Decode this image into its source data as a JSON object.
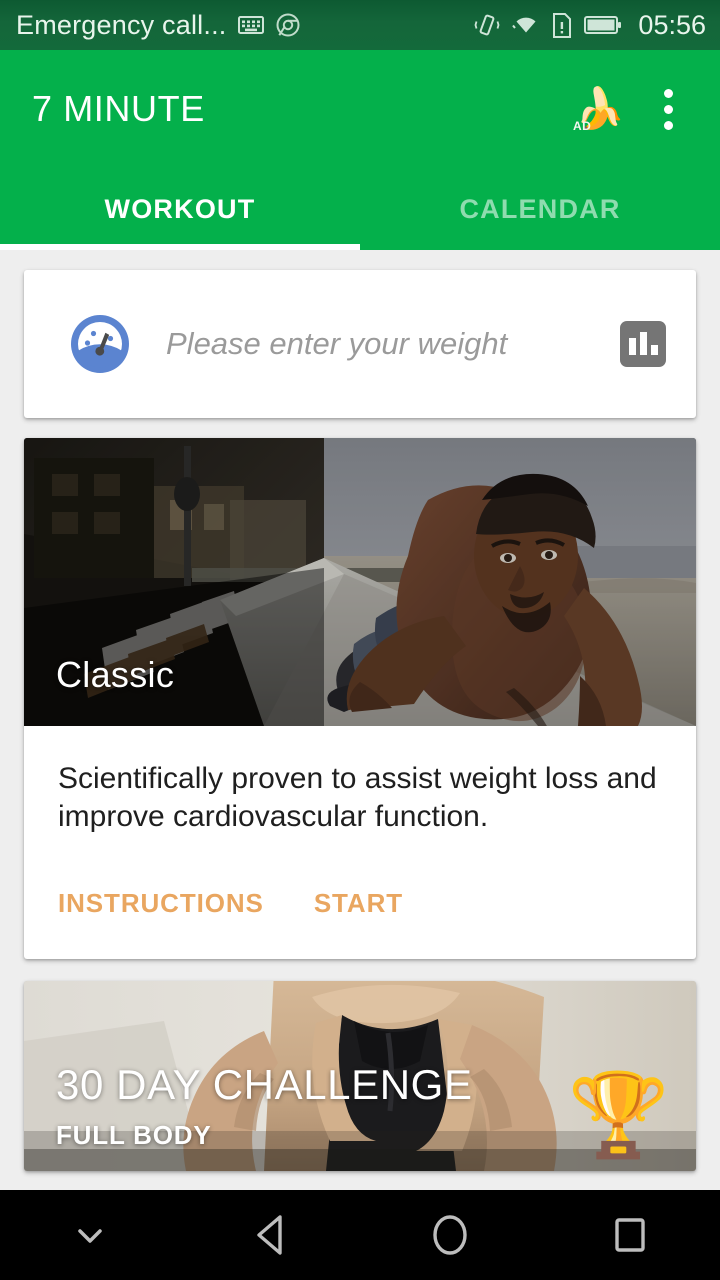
{
  "status_bar": {
    "notification_text": "Emergency call...",
    "icons": [
      "keyboard-icon",
      "chrome-icon"
    ],
    "right_icons": [
      "vibrate-icon",
      "wifi-icon",
      "sim-alert-icon",
      "battery-icon"
    ],
    "time": "05:56"
  },
  "app_bar": {
    "title": "7 MINUTE",
    "ad_icon": "banana-ad-icon",
    "ad_badge": "AD",
    "overflow_icon": "overflow-menu-icon",
    "background_color": "#04b04b"
  },
  "tabs": [
    {
      "label": "WORKOUT",
      "active": true
    },
    {
      "label": "CALENDAR",
      "active": false
    }
  ],
  "weight_card": {
    "scale_icon": "weight-scale-icon",
    "input_value": "",
    "placeholder": "Please enter your weight",
    "chart_button_icon": "bar-chart-icon"
  },
  "workout_card": {
    "hero_icon": "pushup-photo",
    "title": "Classic",
    "description": "Scientifically proven to assist weight loss and improve cardiovascular function.",
    "actions": [
      {
        "label": "INSTRUCTIONS"
      },
      {
        "label": "START"
      }
    ],
    "action_color": "#e9a660"
  },
  "challenge_card": {
    "hero_icon": "female-athlete-photo",
    "title": "30 DAY CHALLENGE",
    "subtitle": "FULL BODY",
    "trophy_icon": "trophy-icon",
    "trophy_glyph": "🏆"
  },
  "nav_bar": {
    "buttons": [
      "hide-keyboard-icon",
      "back-icon",
      "home-icon",
      "recents-icon"
    ]
  }
}
